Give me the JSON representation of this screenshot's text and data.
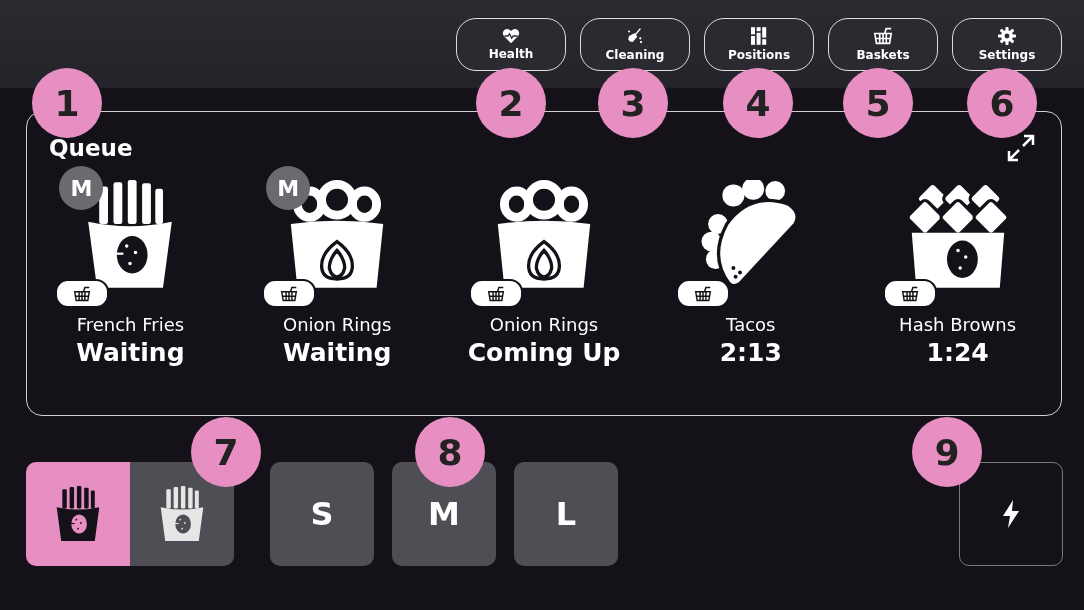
{
  "toolbar": [
    {
      "kind": "health",
      "label": "Health"
    },
    {
      "kind": "cleaning",
      "label": "Cleaning"
    },
    {
      "kind": "positions",
      "label": "Positions"
    },
    {
      "kind": "baskets",
      "label": "Baskets"
    },
    {
      "kind": "settings",
      "label": "Settings"
    }
  ],
  "queue": {
    "title": "Queue",
    "items": [
      {
        "kind": "fries",
        "size_badge": "M",
        "name": "French Fries",
        "status": "Waiting"
      },
      {
        "kind": "onion-rings",
        "size_badge": "M",
        "name": "Onion Rings",
        "status": "Waiting"
      },
      {
        "kind": "onion-rings",
        "name": "Onion Rings",
        "status": "Coming Up"
      },
      {
        "kind": "tacos",
        "name": "Tacos",
        "status": "2:13"
      },
      {
        "kind": "hash-browns",
        "name": "Hash Browns",
        "status": "1:24"
      }
    ]
  },
  "product_toggle": [
    {
      "kind": "fries",
      "selected": true
    },
    {
      "kind": "fries",
      "selected": false
    }
  ],
  "sizes": [
    {
      "label": "S",
      "selected": false
    },
    {
      "label": "M",
      "selected": false
    },
    {
      "label": "L",
      "selected": false
    }
  ],
  "callouts": [
    "1",
    "2",
    "3",
    "4",
    "5",
    "6",
    "7",
    "8",
    "9"
  ]
}
